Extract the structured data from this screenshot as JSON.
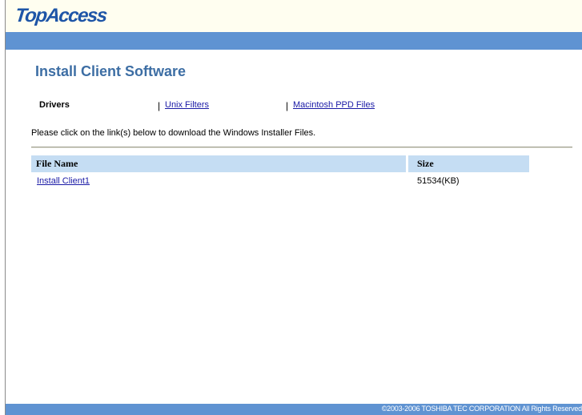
{
  "app": {
    "logo_text": "TopAccess",
    "brand_color": "#1e55a7",
    "band_color": "#5f93d2"
  },
  "page": {
    "title": "Install Client Software"
  },
  "tabs": {
    "drivers_label": "Drivers",
    "unix_label": "Unix Filters",
    "mac_label": "Macintosh PPD Files",
    "separator": "|"
  },
  "instructions": "Please click on the link(s) below to download the Windows Installer Files.",
  "table": {
    "columns": [
      "File Name",
      "Size"
    ],
    "header_color": "#c5ddf3",
    "rows": [
      {
        "name": "Install Client1",
        "size": "51534(KB)"
      }
    ]
  },
  "footer": {
    "copyright": "©2003-2006 TOSHIBA TEC CORPORATION All Rights Reserved"
  }
}
